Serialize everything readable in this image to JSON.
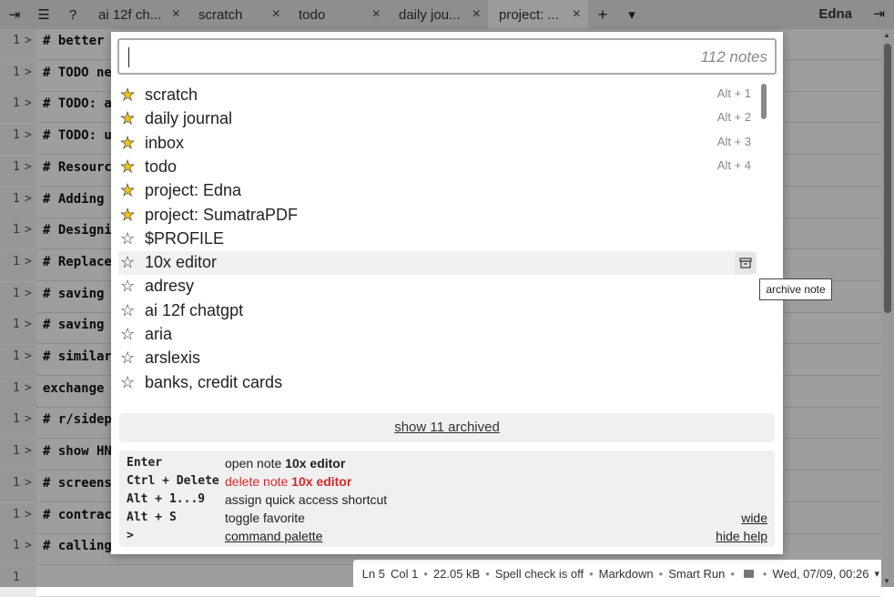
{
  "tabbar": {
    "left_icons": [
      "collapse-sidebar-icon",
      "menu-icon"
    ],
    "help_label": "?",
    "tabs": [
      {
        "label": "ai 12f ch...",
        "close": "×",
        "active": false
      },
      {
        "label": "scratch",
        "close": "×",
        "active": false
      },
      {
        "label": "todo",
        "close": "×",
        "active": false
      },
      {
        "label": "daily jou...",
        "close": "×",
        "active": false
      },
      {
        "label": "project: ...",
        "close": "×",
        "active": true
      }
    ],
    "add_label": "+",
    "dropdown_label": "▾",
    "app_name": "Edna"
  },
  "editor": {
    "lines": [
      {
        "num": "1",
        "chev": ">",
        "text": "# better"
      },
      {
        "num": "1",
        "chev": ">",
        "text": "# TODO ne"
      },
      {
        "num": "1",
        "chev": ">",
        "text": "# TODO: a"
      },
      {
        "num": "1",
        "chev": ">",
        "text": "# TODO: u"
      },
      {
        "num": "1",
        "chev": ">",
        "text": "# Resourc"
      },
      {
        "num": "1",
        "chev": ">",
        "text": "# Adding"
      },
      {
        "num": "1",
        "chev": ">",
        "text": "# Designi"
      },
      {
        "num": "1",
        "chev": ">",
        "text": "# Replace"
      },
      {
        "num": "1",
        "chev": ">",
        "text": "# saving"
      },
      {
        "num": "1",
        "chev": ">",
        "text": "# saving"
      },
      {
        "num": "1",
        "chev": ">",
        "text": "# similar"
      },
      {
        "num": "1",
        "chev": ">",
        "text": "exchange"
      },
      {
        "num": "1",
        "chev": ">",
        "text": "# r/sidep"
      },
      {
        "num": "1",
        "chev": ">",
        "text": "# show HN"
      },
      {
        "num": "1",
        "chev": ">",
        "text": "# screens"
      },
      {
        "num": "1",
        "chev": ">",
        "text": "# contrac"
      },
      {
        "num": "1",
        "chev": ">",
        "text": "# calling"
      },
      {
        "num": "1",
        "chev": "",
        "text": ""
      }
    ]
  },
  "statusbar": {
    "ln": "Ln 5",
    "col": "Col 1",
    "size": "22.05 kB",
    "spell": "Spell check is off",
    "lang": "Markdown",
    "run": "Smart Run",
    "datetime": "Wed, 07/09, 00:26",
    "menu_label": "▾",
    "sep": "•"
  },
  "modal": {
    "search": {
      "value": "",
      "placeholder": ""
    },
    "note_count": "112 notes",
    "notes": [
      {
        "name": "scratch",
        "favorite": true,
        "shortcut": "Alt + 1"
      },
      {
        "name": "daily journal",
        "favorite": true,
        "shortcut": "Alt + 2"
      },
      {
        "name": "inbox",
        "favorite": true,
        "shortcut": "Alt + 3"
      },
      {
        "name": "todo",
        "favorite": true,
        "shortcut": "Alt + 4"
      },
      {
        "name": "project: Edna",
        "favorite": true,
        "shortcut": ""
      },
      {
        "name": "project: SumatraPDF",
        "favorite": true,
        "shortcut": ""
      },
      {
        "name": "$PROFILE",
        "favorite": false,
        "shortcut": ""
      },
      {
        "name": "10x editor",
        "favorite": false,
        "shortcut": "",
        "hover": true
      },
      {
        "name": "adresy",
        "favorite": false,
        "shortcut": ""
      },
      {
        "name": "ai 12f chatgpt",
        "favorite": false,
        "shortcut": ""
      },
      {
        "name": "aria",
        "favorite": false,
        "shortcut": ""
      },
      {
        "name": "arslexis",
        "favorite": false,
        "shortcut": ""
      },
      {
        "name": "banks, credit cards",
        "favorite": false,
        "shortcut": ""
      }
    ],
    "star_on": "★",
    "star_off": "☆",
    "show_archived": "show 11 archived",
    "tooltip": "archive note",
    "help": {
      "rows": [
        {
          "key": "Enter",
          "desc_prefix": "open note ",
          "desc_name": "10x editor",
          "right": ""
        },
        {
          "key": "Ctrl + Delete",
          "desc_prefix": "delete note ",
          "desc_name": "10x editor",
          "right": ""
        },
        {
          "key": "Alt + 1...9",
          "desc": "assign quick access shortcut",
          "right": ""
        },
        {
          "key": "Alt + S",
          "desc": "toggle favorite",
          "right": "wide"
        },
        {
          "key": ">",
          "desc": "command palette",
          "right": "hide help"
        }
      ]
    }
  },
  "colors": {
    "star": "#f0c419",
    "delete": "#d42a2a"
  }
}
